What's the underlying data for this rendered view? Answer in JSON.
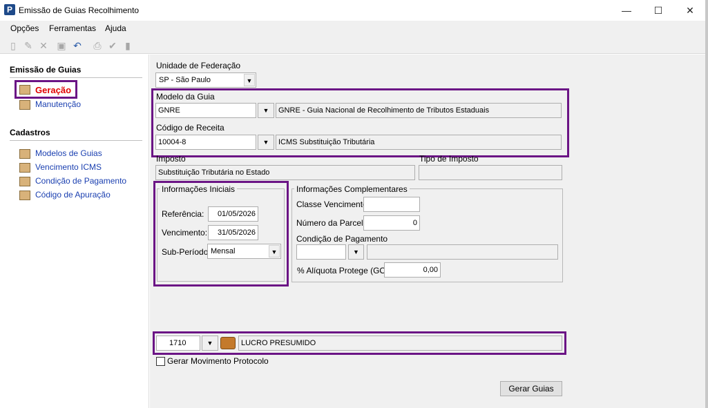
{
  "window": {
    "title": "Emissão de Guias Recolhimento",
    "minimize": "—",
    "maximize": "☐",
    "close": "✕"
  },
  "menu": [
    "Opções",
    "Ferramentas",
    "Ajuda"
  ],
  "toolbar_icons": [
    "new-icon",
    "edit-icon",
    "delete-icon",
    "save-icon",
    "undo-icon",
    "print-icon",
    "check-icon",
    "document-icon"
  ],
  "sidebar": {
    "section1_title": "Emissão de Guias",
    "section1_items": [
      {
        "label": "Geração"
      },
      {
        "label": "Manutenção"
      }
    ],
    "section2_title": "Cadastros",
    "section2_items": [
      {
        "label": "Modelos de Guias"
      },
      {
        "label": "Vencimento ICMS"
      },
      {
        "label": "Condição de Pagamento"
      },
      {
        "label": "Código de Apuração"
      }
    ]
  },
  "form": {
    "uf_label": "Unidade de Federação",
    "uf_value": "SP - São Paulo",
    "modelo_label": "Modelo da Guia",
    "modelo_value": "GNRE",
    "modelo_desc": "GNRE - Guia Nacional de Recolhimento de Tributos Estaduais",
    "receita_label": "Código de Receita",
    "receita_value": "10004-8",
    "receita_desc": "ICMS Substituição Tributária",
    "imposto_label": "Imposto",
    "imposto_value": "Substituição Tributária no Estado",
    "tipo_imposto_label": "Tipo de Imposto",
    "tipo_imposto_value": ""
  },
  "info_iniciais": {
    "title": "Informações Iniciais",
    "referencia_label": "Referência:",
    "referencia_value": "01/05/2026",
    "vencimento_label": "Vencimento:",
    "vencimento_value": "31/05/2026",
    "subperiodo_label": "Sub-Período:",
    "subperiodo_value": "Mensal"
  },
  "info_complementares": {
    "title": "Informações Complementares",
    "classe_label": "Classe Vencimento:",
    "classe_value": "",
    "parcela_label": "Número da Parcela:",
    "parcela_value": "0",
    "condicao_label": "Condição de Pagamento",
    "condicao_code": "",
    "condicao_desc": "",
    "aliquota_label": "% Alíquota Protege (GO):",
    "aliquota_value": "0,00"
  },
  "empresa": {
    "code": "1710",
    "name": "LUCRO PRESUMIDO"
  },
  "gerar_movimento_label": "Gerar Movimento Protocolo",
  "gerar_guias_label": "Gerar Guias",
  "colors": {
    "highlight": "#6b1485",
    "link": "#1a3fb0",
    "active_link": "#e00000"
  }
}
